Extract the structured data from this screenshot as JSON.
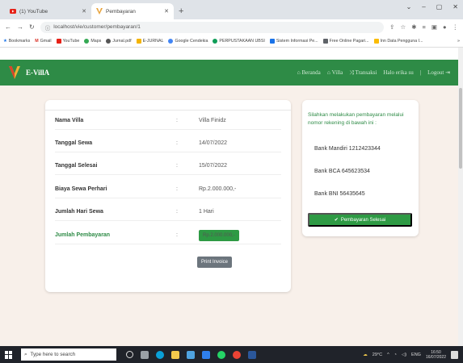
{
  "browser": {
    "tabs": [
      {
        "title": "(1) YouTube"
      },
      {
        "title": "Pembayaran"
      }
    ],
    "new_tab": "+",
    "url": "localhost/vie/customer/pembayaran/1",
    "bookmarks": [
      "Bookmarks",
      "Gmail",
      "YouTube",
      "Maps",
      "Jurnal.pdf",
      "E-JURNAL",
      "Google Cendekia",
      "PERPUSTAKAAN UBSI",
      "Sistem Informasi Pe...",
      "Free Online Pagari...",
      "Inn Data Pengguna I..."
    ],
    "bookmarks_more": "»"
  },
  "site": {
    "brand": "E-VillA",
    "menu": [
      "Beranda",
      "Villa",
      "Transaksi",
      "Halo erika su",
      "Logout"
    ]
  },
  "booking": {
    "rows": [
      {
        "label": "Nama Villa",
        "sep": ":",
        "value": "Villa Finidz"
      },
      {
        "label": "Tanggal Sewa",
        "sep": ":",
        "value": "14/07/2022"
      },
      {
        "label": "Tanggal Selesai",
        "sep": ":",
        "value": "15/07/2022"
      },
      {
        "label": "Biaya Sewa Perhari",
        "sep": ":",
        "value": "Rp.2.000.000,-"
      },
      {
        "label": "Jumlah Hari Sewa",
        "sep": ":",
        "value": "1 Hari"
      }
    ],
    "payment": {
      "label": "Jumlah Pembayaran",
      "sep": ":",
      "value": "Rp.2.000.000,-"
    },
    "print_label": "Print Invoice"
  },
  "payment_info": {
    "instruction": "Silahkan melakukan pembayaran melalui nomor rekening di bawah ini :",
    "banks": [
      "Bank Mandiri 1212423344",
      "Bank BCA 645623534",
      "Bank BNI 56435645"
    ],
    "done_label": "Pembayaran Selesai"
  },
  "taskbar": {
    "search_placeholder": "Type here to search",
    "weather": "29°C",
    "lang": "ENG",
    "time": "16:50",
    "date": "16/07/2022"
  },
  "colors": {
    "navbar": "#2e8b46",
    "accent_green": "#2e9a44",
    "page_bg": "#f8f0ea"
  }
}
